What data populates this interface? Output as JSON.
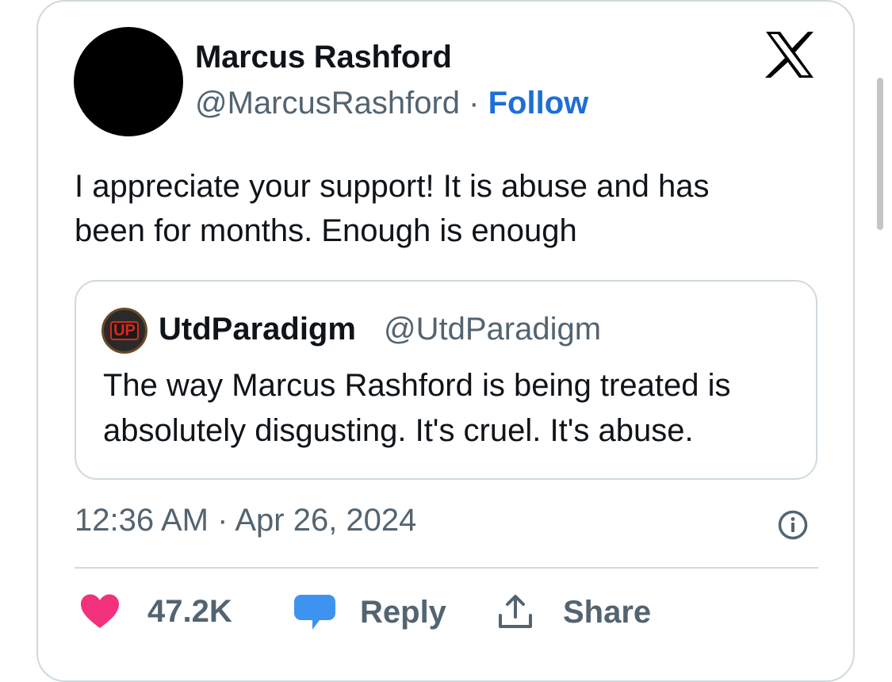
{
  "author": {
    "name": "Marcus Rashford",
    "handle": "@MarcusRashford",
    "separator": "·",
    "follow_label": "Follow"
  },
  "tweet": {
    "text": "I appreciate your support! It is abuse and has been for months. Enough is enough",
    "timestamp": "12:36 AM · Apr 26, 2024"
  },
  "quoted": {
    "avatar_text": "UP",
    "name": "UtdParadigm",
    "handle": "@UtdParadigm",
    "text": "The way Marcus Rashford is being treated is absolutely disgusting. It's cruel. It's abuse."
  },
  "actions": {
    "like_count": "47.2K",
    "reply_label": "Reply",
    "share_label": "Share"
  },
  "icons": {
    "platform": "x-logo-icon",
    "info": "info-icon",
    "like": "heart-icon",
    "reply": "speech-bubble-icon",
    "share": "share-upload-icon"
  },
  "colors": {
    "follow": "#1d6fd6",
    "heart": "#f2317c",
    "bubble": "#3f93f0",
    "secondary_text": "#536471",
    "border": "#cfd9de"
  }
}
